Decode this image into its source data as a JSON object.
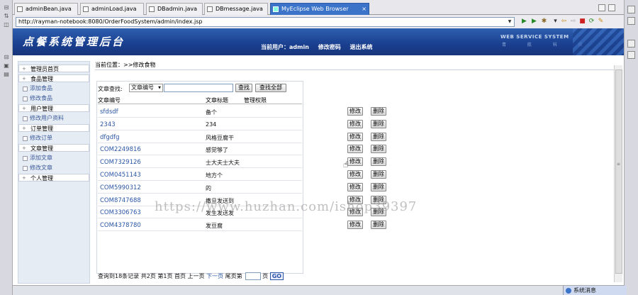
{
  "tabs": [
    {
      "label": "adminBean.java",
      "active": false
    },
    {
      "label": "adminLoad.java",
      "active": false
    },
    {
      "label": "DBadmin.java",
      "active": false
    },
    {
      "label": "DBmessage.java",
      "active": false
    },
    {
      "label": "MyEclipse Web Browser",
      "active": true
    }
  ],
  "tab_close": "×",
  "url": "http://rayman-notebook:8080/OrderFoodSystem/admin/index.jsp",
  "banner": {
    "logo": "点餐系统管理后台",
    "current_user_label": "当前用户：",
    "current_user": "admin",
    "change_password": "修改密码",
    "logout": "退出系统",
    "ws_title": "WEB SERVICE SYSTEM",
    "ws_sub": "青 航 科 技"
  },
  "menu": [
    {
      "label": "管理员首页",
      "type": "hd"
    },
    {
      "label": "食品管理",
      "type": "hd"
    },
    {
      "label": "添加食品",
      "type": "sub"
    },
    {
      "label": "修改食品",
      "type": "sub"
    },
    {
      "label": "用户管理",
      "type": "hd"
    },
    {
      "label": "修改用户资料",
      "type": "sub"
    },
    {
      "label": "订单管理",
      "type": "hd"
    },
    {
      "label": "修改订单",
      "type": "sub"
    },
    {
      "label": "文章管理",
      "type": "hd"
    },
    {
      "label": "添加文章",
      "type": "sub"
    },
    {
      "label": "修改文章",
      "type": "sub"
    },
    {
      "label": "个人管理",
      "type": "hd"
    }
  ],
  "breadcrumb": "当前位置：>>修改食物",
  "search": {
    "label": "文章查找:",
    "select_value": "文章编号",
    "input_value": "",
    "find_button": "查找",
    "find_all_button": "查找全部"
  },
  "table": {
    "headers": [
      "文章编号",
      "文章标题",
      "管理权限"
    ],
    "edit_label": "修改",
    "delete_label": "删除",
    "rows": [
      {
        "id": "sfdsdf",
        "title": "备个"
      },
      {
        "id": "2343",
        "title": "234"
      },
      {
        "id": "dfgdfg",
        "title": "风格豆腐干"
      },
      {
        "id": "COM2249816",
        "title": "感觉够了"
      },
      {
        "id": "COM7329126",
        "title": "士大夫士大夫"
      },
      {
        "id": "COM0451143",
        "title": "地方个"
      },
      {
        "id": "COM5990312",
        "title": "的"
      },
      {
        "id": "COM8747688",
        "title": "撒旦发送到"
      },
      {
        "id": "COM3306763",
        "title": "发生发送发"
      },
      {
        "id": "COM4378780",
        "title": "发豆腐"
      }
    ]
  },
  "pager": {
    "text": "查询到18条记录 共2页 第1页 首页 上一页",
    "next": "下一页",
    "last": "尾页",
    "jump_prefix": "第",
    "jump_suffix": "页",
    "go": "GO"
  },
  "watermark": "https://www.huzhan.com/ishop39397",
  "status_message": "系统消息",
  "icons": {
    "cursor": "hand-pointer-icon"
  }
}
